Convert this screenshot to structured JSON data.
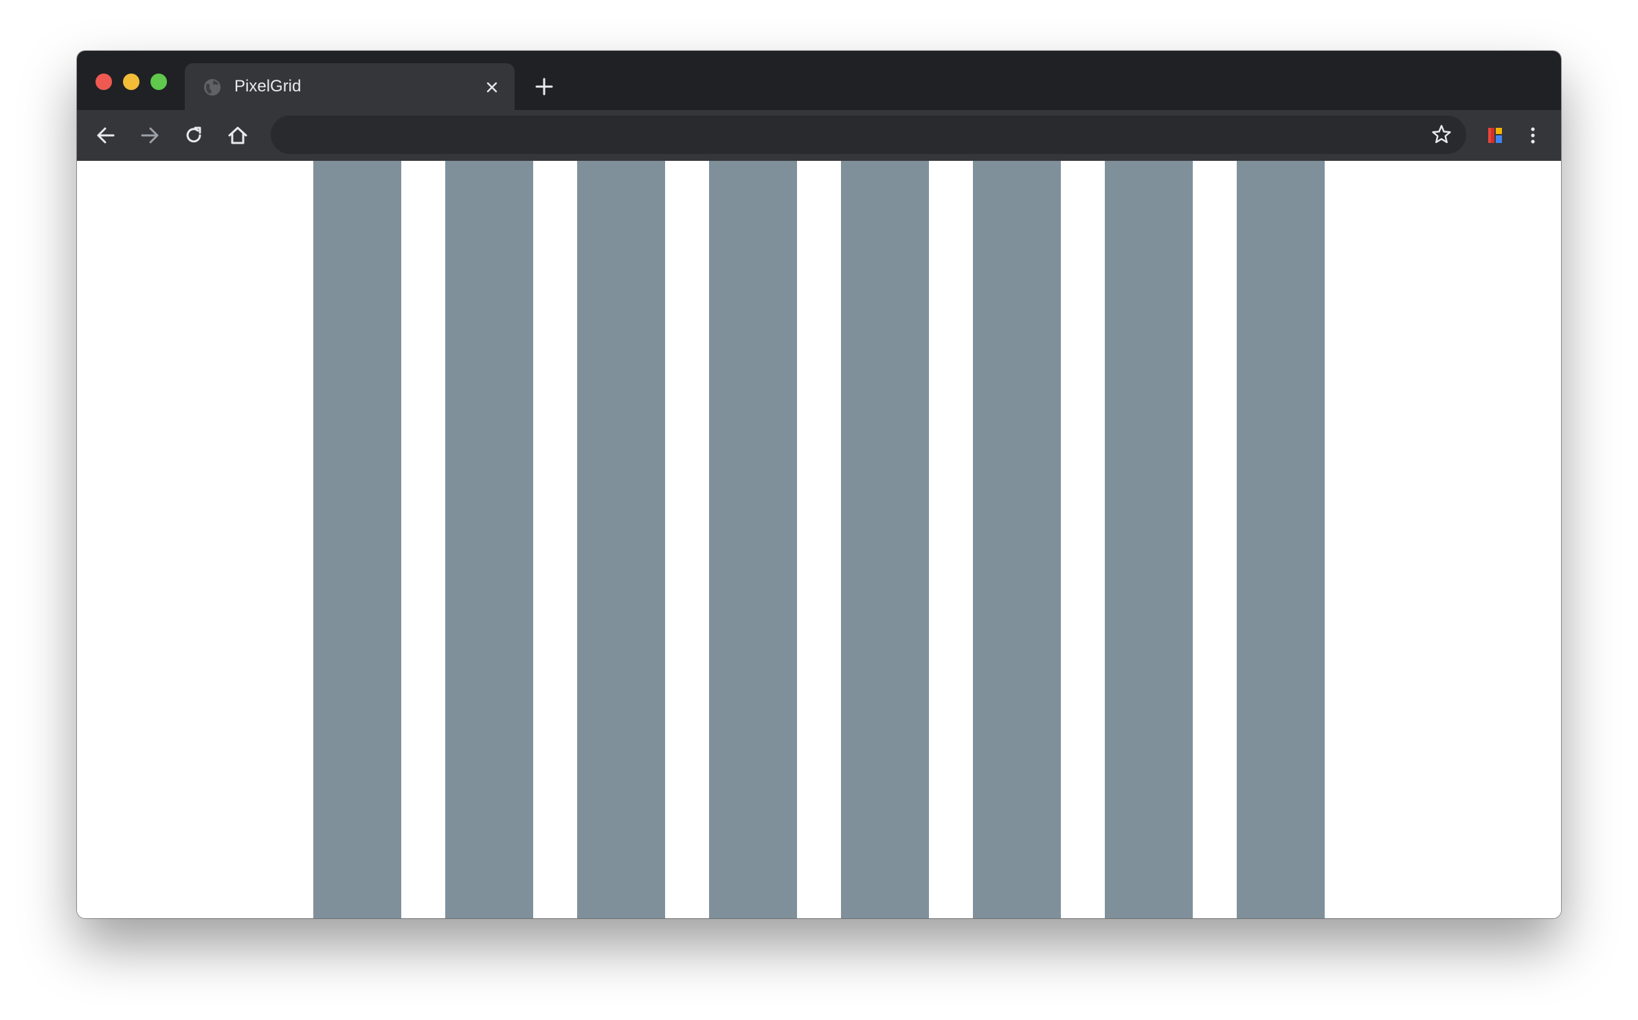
{
  "colors": {
    "titlebar": "#202124",
    "tab_active": "#35363a",
    "toolbar": "#35363a",
    "omnibox": "#292a2d",
    "icon": "#e8eaed",
    "icon_disabled": "#9aa0a6",
    "traffic_close": "#ee5a52",
    "traffic_minimize": "#f3bd38",
    "traffic_maximize": "#5fc84d",
    "grid_column": "#7f909b",
    "page_background": "#ffffff"
  },
  "tabs": [
    {
      "title": "PixelGrid",
      "favicon": "globe-icon",
      "active": true
    }
  ],
  "toolbar": {
    "back": "arrow-left-icon",
    "forward": "arrow-right-icon",
    "reload": "reload-icon",
    "home": "home-icon",
    "address_value": "",
    "bookmark": "star-icon",
    "extension": "extension-icon",
    "menu": "kebab-menu-icon"
  },
  "page": {
    "grid": {
      "column_count": 8,
      "color": "#7f909b"
    }
  }
}
